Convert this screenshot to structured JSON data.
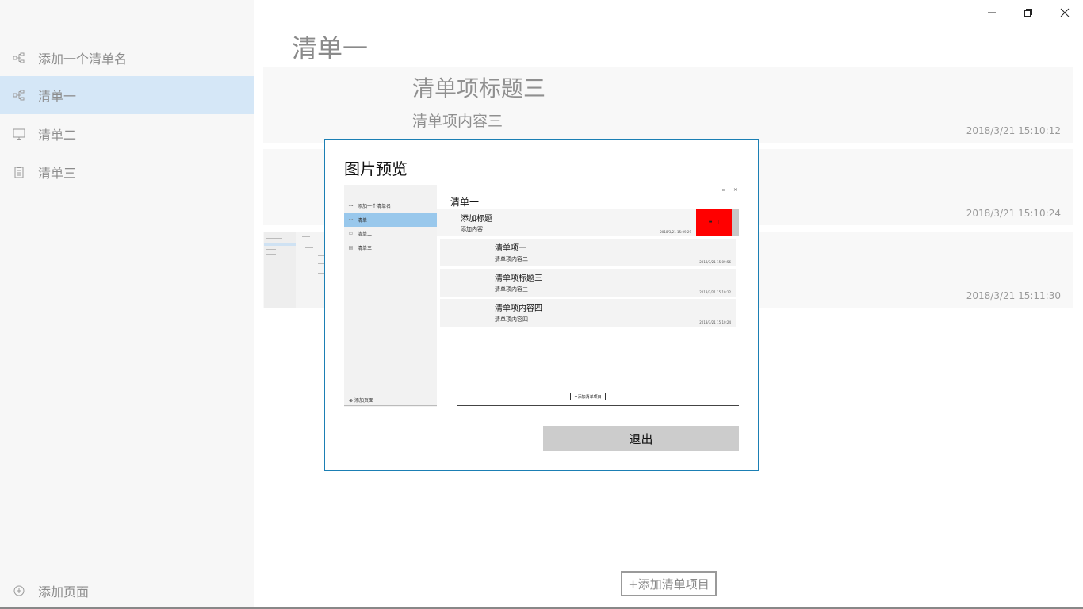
{
  "window": {
    "controls": {
      "minimize": "—",
      "restore": "⧉",
      "close": "✕"
    }
  },
  "sidebar": {
    "items": [
      {
        "label": "添加一个清单名",
        "icon": "hierarchy-icon"
      },
      {
        "label": "清单一",
        "icon": "hierarchy-icon",
        "selected": true
      },
      {
        "label": "清单二",
        "icon": "monitor-icon"
      },
      {
        "label": "清单三",
        "icon": "clipboard-icon"
      }
    ],
    "add_page": {
      "label": "添加页面",
      "icon": "plus-circle-icon"
    }
  },
  "main": {
    "title": "清单一",
    "cards": [
      {
        "title": "清单项标题三",
        "content": "清单项内容三",
        "date": "2018/3/21 15:10:12"
      },
      {
        "title": "",
        "content": "",
        "date": "2018/3/21 15:10:24"
      },
      {
        "title": "",
        "content": "",
        "date": "2018/3/21 15:11:30"
      }
    ],
    "add_item_label": "+添加清单项目"
  },
  "dialog": {
    "title": "图片预览",
    "exit_label": "退出",
    "preview": {
      "sidebar": [
        {
          "label": "添加一个清单名"
        },
        {
          "label": "清单一",
          "selected": true
        },
        {
          "label": "清单二"
        },
        {
          "label": "清单三"
        }
      ],
      "add_page": "添加页面",
      "title": "清单一",
      "new_item": {
        "title": "添加标题",
        "content": "添加内容",
        "date": "2018/3/21 15:09:29"
      },
      "items": [
        {
          "title": "清单项一",
          "content": "清单项内容二",
          "date": "2018/3/21 15:09:56"
        },
        {
          "title": "清单项标题三",
          "content": "清单项内容三",
          "date": "2018/3/21 15:10:12"
        },
        {
          "title": "清单项内容四",
          "content": "清单项内容四",
          "date": "2018/3/21 15:10:24"
        }
      ],
      "add_item": "+添加清单项目"
    }
  },
  "colors": {
    "selected_bg": "#d5e7f7",
    "dialog_border": "#1b7fb4",
    "swipe_red": "#ff0000",
    "exit_button": "#cccccc"
  }
}
